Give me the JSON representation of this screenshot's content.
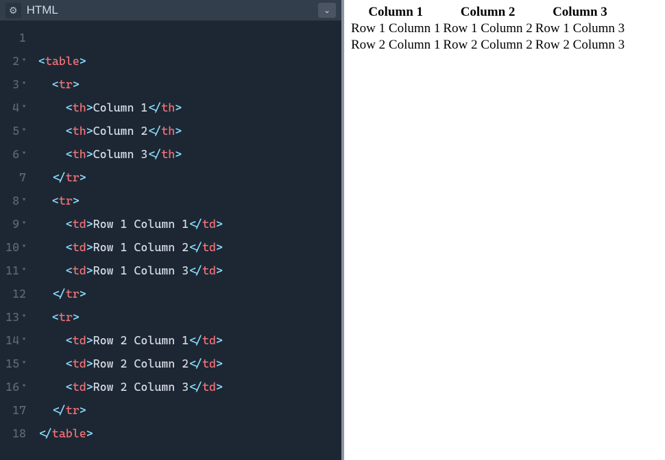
{
  "editor": {
    "title": "HTML",
    "lines": [
      {
        "num": "1",
        "fold": false,
        "tokens": []
      },
      {
        "num": "2",
        "fold": true,
        "tokens": [
          {
            "t": "angle",
            "v": "<"
          },
          {
            "t": "tag",
            "v": "table"
          },
          {
            "t": "angle",
            "v": ">"
          }
        ]
      },
      {
        "num": "3",
        "fold": true,
        "tokens": [
          {
            "t": "text",
            "v": "  "
          },
          {
            "t": "angle",
            "v": "<"
          },
          {
            "t": "tag",
            "v": "tr"
          },
          {
            "t": "angle",
            "v": ">"
          }
        ]
      },
      {
        "num": "4",
        "fold": true,
        "tokens": [
          {
            "t": "text",
            "v": "    "
          },
          {
            "t": "angle",
            "v": "<"
          },
          {
            "t": "tag",
            "v": "th"
          },
          {
            "t": "angle",
            "v": ">"
          },
          {
            "t": "text",
            "v": "Column 1"
          },
          {
            "t": "angle",
            "v": "</"
          },
          {
            "t": "tag",
            "v": "th"
          },
          {
            "t": "angle",
            "v": ">"
          }
        ]
      },
      {
        "num": "5",
        "fold": true,
        "tokens": [
          {
            "t": "text",
            "v": "    "
          },
          {
            "t": "angle",
            "v": "<"
          },
          {
            "t": "tag",
            "v": "th"
          },
          {
            "t": "angle",
            "v": ">"
          },
          {
            "t": "text",
            "v": "Column 2"
          },
          {
            "t": "angle",
            "v": "</"
          },
          {
            "t": "tag",
            "v": "th"
          },
          {
            "t": "angle",
            "v": ">"
          }
        ]
      },
      {
        "num": "6",
        "fold": true,
        "tokens": [
          {
            "t": "text",
            "v": "    "
          },
          {
            "t": "angle",
            "v": "<"
          },
          {
            "t": "tag",
            "v": "th"
          },
          {
            "t": "angle",
            "v": ">"
          },
          {
            "t": "text",
            "v": "Column 3"
          },
          {
            "t": "angle",
            "v": "</"
          },
          {
            "t": "tag",
            "v": "th"
          },
          {
            "t": "angle",
            "v": ">"
          }
        ]
      },
      {
        "num": "7",
        "fold": false,
        "tokens": [
          {
            "t": "text",
            "v": "  "
          },
          {
            "t": "angle",
            "v": "</"
          },
          {
            "t": "tag",
            "v": "tr"
          },
          {
            "t": "angle",
            "v": ">"
          }
        ]
      },
      {
        "num": "8",
        "fold": true,
        "tokens": [
          {
            "t": "text",
            "v": "  "
          },
          {
            "t": "angle",
            "v": "<"
          },
          {
            "t": "tag",
            "v": "tr"
          },
          {
            "t": "angle",
            "v": ">"
          }
        ]
      },
      {
        "num": "9",
        "fold": true,
        "tokens": [
          {
            "t": "text",
            "v": "    "
          },
          {
            "t": "angle",
            "v": "<"
          },
          {
            "t": "tag",
            "v": "td"
          },
          {
            "t": "angle",
            "v": ">"
          },
          {
            "t": "text",
            "v": "Row 1 Column 1"
          },
          {
            "t": "angle",
            "v": "</"
          },
          {
            "t": "tag",
            "v": "td"
          },
          {
            "t": "angle",
            "v": ">"
          }
        ]
      },
      {
        "num": "10",
        "fold": true,
        "tokens": [
          {
            "t": "text",
            "v": "    "
          },
          {
            "t": "angle",
            "v": "<"
          },
          {
            "t": "tag",
            "v": "td"
          },
          {
            "t": "angle",
            "v": ">"
          },
          {
            "t": "text",
            "v": "Row 1 Column 2"
          },
          {
            "t": "angle",
            "v": "</"
          },
          {
            "t": "tag",
            "v": "td"
          },
          {
            "t": "angle",
            "v": ">"
          }
        ]
      },
      {
        "num": "11",
        "fold": true,
        "tokens": [
          {
            "t": "text",
            "v": "    "
          },
          {
            "t": "angle",
            "v": "<"
          },
          {
            "t": "tag",
            "v": "td"
          },
          {
            "t": "angle",
            "v": ">"
          },
          {
            "t": "text",
            "v": "Row 1 Column 3"
          },
          {
            "t": "angle",
            "v": "</"
          },
          {
            "t": "tag",
            "v": "td"
          },
          {
            "t": "angle",
            "v": ">"
          }
        ]
      },
      {
        "num": "12",
        "fold": false,
        "tokens": [
          {
            "t": "text",
            "v": "  "
          },
          {
            "t": "angle",
            "v": "</"
          },
          {
            "t": "tag",
            "v": "tr"
          },
          {
            "t": "angle",
            "v": ">"
          }
        ]
      },
      {
        "num": "13",
        "fold": true,
        "tokens": [
          {
            "t": "text",
            "v": "  "
          },
          {
            "t": "angle",
            "v": "<"
          },
          {
            "t": "tag",
            "v": "tr"
          },
          {
            "t": "angle",
            "v": ">"
          }
        ]
      },
      {
        "num": "14",
        "fold": true,
        "tokens": [
          {
            "t": "text",
            "v": "    "
          },
          {
            "t": "angle",
            "v": "<"
          },
          {
            "t": "tag",
            "v": "td"
          },
          {
            "t": "angle",
            "v": ">"
          },
          {
            "t": "text",
            "v": "Row 2 Column 1"
          },
          {
            "t": "angle",
            "v": "</"
          },
          {
            "t": "tag",
            "v": "td"
          },
          {
            "t": "angle",
            "v": ">"
          }
        ]
      },
      {
        "num": "15",
        "fold": true,
        "tokens": [
          {
            "t": "text",
            "v": "    "
          },
          {
            "t": "angle",
            "v": "<"
          },
          {
            "t": "tag",
            "v": "td"
          },
          {
            "t": "angle",
            "v": ">"
          },
          {
            "t": "text",
            "v": "Row 2 Column 2"
          },
          {
            "t": "angle",
            "v": "</"
          },
          {
            "t": "tag",
            "v": "td"
          },
          {
            "t": "angle",
            "v": ">"
          }
        ]
      },
      {
        "num": "16",
        "fold": true,
        "tokens": [
          {
            "t": "text",
            "v": "    "
          },
          {
            "t": "angle",
            "v": "<"
          },
          {
            "t": "tag",
            "v": "td"
          },
          {
            "t": "angle",
            "v": ">"
          },
          {
            "t": "text",
            "v": "Row 2 Column 3"
          },
          {
            "t": "angle",
            "v": "</"
          },
          {
            "t": "tag",
            "v": "td"
          },
          {
            "t": "angle",
            "v": ">"
          }
        ]
      },
      {
        "num": "17",
        "fold": false,
        "tokens": [
          {
            "t": "text",
            "v": "  "
          },
          {
            "t": "angle",
            "v": "</"
          },
          {
            "t": "tag",
            "v": "tr"
          },
          {
            "t": "angle",
            "v": ">"
          }
        ]
      },
      {
        "num": "18",
        "fold": false,
        "tokens": [
          {
            "t": "angle",
            "v": "</"
          },
          {
            "t": "tag",
            "v": "table"
          },
          {
            "t": "angle",
            "v": ">"
          }
        ]
      }
    ]
  },
  "preview": {
    "headers": [
      "Column 1",
      "Column 2",
      "Column 3"
    ],
    "rows": [
      [
        "Row 1 Column 1",
        "Row 1 Column 2",
        "Row 1 Column 3"
      ],
      [
        "Row 2 Column 1",
        "Row 2 Column 2",
        "Row 2 Column 3"
      ]
    ]
  }
}
